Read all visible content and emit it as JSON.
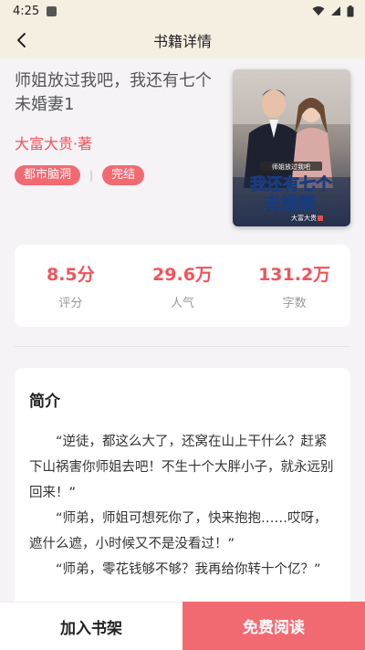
{
  "status_bar": {
    "time": "4:25"
  },
  "nav": {
    "title": "书籍详情"
  },
  "book": {
    "title": "师姐放过我吧，我还有七个未婚妻1",
    "author": "大富大贵·著",
    "tags": [
      "都市脑洞",
      "完结"
    ],
    "tag_separator": "|",
    "cover": {
      "top_caption": "师姐放过我吧",
      "main_title_line1": "我还有七个",
      "main_title_line2": "未婚妻",
      "author_mark": "大富大贵"
    }
  },
  "stats": [
    {
      "value": "8.5分",
      "label": "评分"
    },
    {
      "value": "29.6万",
      "label": "人气"
    },
    {
      "value": "131.2万",
      "label": "字数"
    }
  ],
  "intro": {
    "heading": "简介",
    "paragraphs": [
      "“逆徒，都这么大了，还窝在山上干什么？赶紧下山祸害你师姐去吧！不生十个大胖小子，就永远别回来！”",
      "“师弟，师姐可想死你了，快来抱抱……哎呀，遮什么遮，小时候又不是没看过！”",
      "“师弟，零花钱够不够？我再给你转十个亿？”"
    ]
  },
  "bottom": {
    "add_shelf": "加入书架",
    "read_free": "免费阅读"
  },
  "colors": {
    "accent": "#f26a71",
    "accent_text": "#f0545c",
    "header_bg": "#f5efe1",
    "page_bg": "#f5f3f6"
  }
}
